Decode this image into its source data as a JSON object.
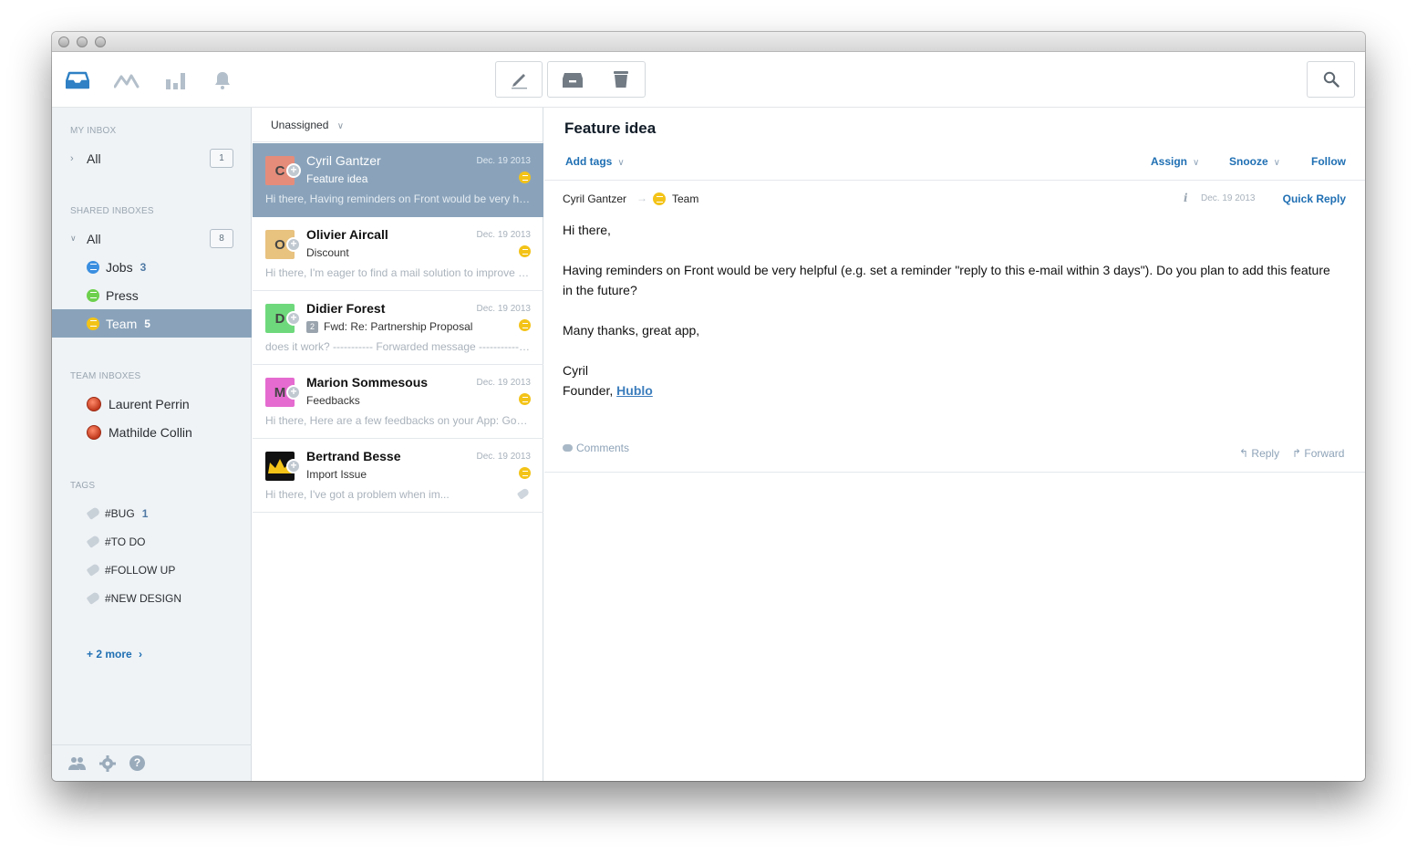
{
  "toolbar": {
    "icons": [
      "inbox-icon",
      "activity-icon",
      "analytics-icon",
      "notifications-icon"
    ],
    "actions": [
      "compose-icon",
      "archive-icon",
      "trash-icon",
      "search-icon"
    ],
    "accent": "#2f80c4"
  },
  "sidebar": {
    "my_inbox_title": "MY INBOX",
    "my_all": {
      "label": "All",
      "badge": "1"
    },
    "shared_title": "SHARED INBOXES",
    "shared_all": {
      "label": "All",
      "badge": "8"
    },
    "shared_items": [
      {
        "label": "Jobs",
        "count": "3",
        "color": "#3b8fe0"
      },
      {
        "label": "Press",
        "count": "",
        "color": "#6dd04d"
      },
      {
        "label": "Team",
        "count": "5",
        "color": "#f3c318"
      }
    ],
    "team_title": "TEAM INBOXES",
    "team_items": [
      {
        "label": "Laurent Perrin"
      },
      {
        "label": "Mathilde Collin"
      }
    ],
    "tags_title": "TAGS",
    "tags": [
      {
        "label": "#BUG",
        "count": "1"
      },
      {
        "label": "#TO DO",
        "count": ""
      },
      {
        "label": "#FOLLOW UP",
        "count": ""
      },
      {
        "label": "#NEW DESIGN",
        "count": ""
      }
    ],
    "more_label": "+ 2 more",
    "footer_icons": [
      "users-icon",
      "settings-icon",
      "help-icon"
    ]
  },
  "list": {
    "filter_label": "Unassigned",
    "conversations": [
      {
        "initial": "C",
        "av_color": "#e58c7b",
        "name": "Cyril Gantzer",
        "date": "Dec. 19 2013",
        "subject": "Feature idea",
        "count": "",
        "preview": "Hi there, Having reminders on Front would be very helpful (e.g. set a reminder",
        "active": true
      },
      {
        "initial": "O",
        "av_color": "#e8c27f",
        "name": "Olivier Aircall",
        "date": "Dec. 19 2013",
        "subject": "Discount",
        "count": "",
        "preview": "Hi there, I'm eager to find a mail solution to improve our team workflow",
        "active": false
      },
      {
        "initial": "D",
        "av_color": "#6ed97c",
        "name": "Didier Forest",
        "date": "Dec. 19 2013",
        "subject": "Fwd: Re: Partnership Proposal",
        "count": "2",
        "preview": "does it work? ----------- Forwarded message ----------- From:",
        "active": false
      },
      {
        "initial": "M",
        "av_color": "#e56bd0",
        "name": "Marion Sommesous",
        "date": "Dec. 19 2013",
        "subject": "Feedbacks",
        "count": "",
        "preview": "Hi there, Here are a few feedbacks on your App: Good job on the design",
        "active": false
      },
      {
        "initial": "",
        "av_color": "#111111",
        "name": "Bertrand Besse",
        "date": "Dec. 19 2013",
        "subject": "Import Issue",
        "count": "",
        "preview": "Hi there, I've got a problem when im...",
        "active": false
      }
    ]
  },
  "detail": {
    "title": "Feature idea",
    "add_tags": "Add tags",
    "assign": "Assign",
    "snooze": "Snooze",
    "follow": "Follow",
    "from": "Cyril Gantzer",
    "arrow": "→",
    "to": "Team",
    "date": "Dec. 19 2013",
    "quick_reply": "Quick Reply",
    "body_greeting": "Hi there,",
    "body_line1": "Having reminders on Front would be very helpful (e.g. set a reminder \"reply to this e-mail within 3 days\"). Do you plan to add this feature",
    "body_line2": "in the future?",
    "body_thanks": "Many thanks, great app,",
    "sig_name": "Cyril",
    "sig_role": "Founder,",
    "sig_company": "Hublo",
    "comments": "Comments",
    "reply": "Reply",
    "forward": "Forward"
  }
}
